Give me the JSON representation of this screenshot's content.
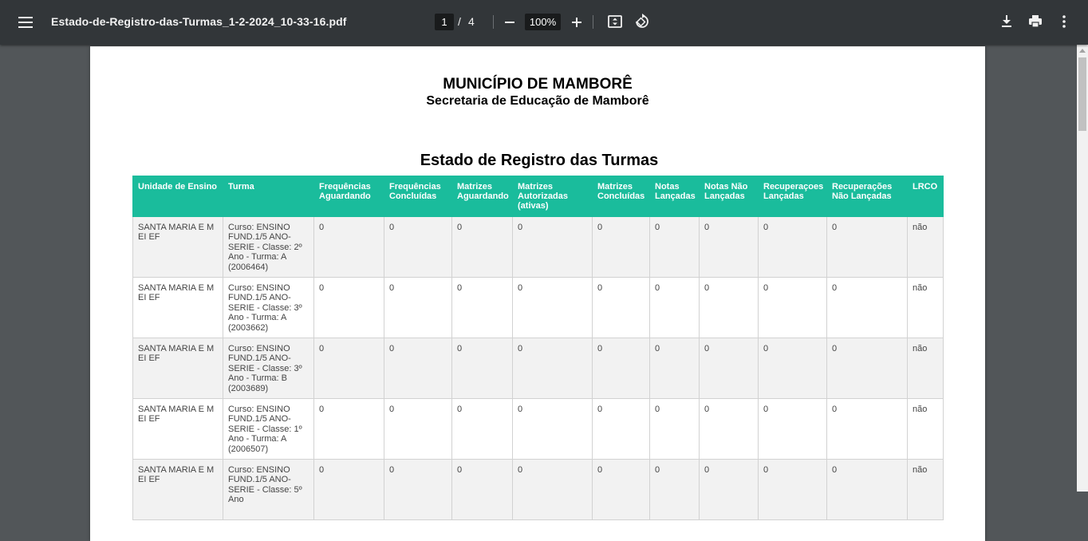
{
  "viewer": {
    "filename": "Estado-de-Registro-das-Turmas_1-2-2024_10-33-16.pdf",
    "page_current": "1",
    "page_separator": "/",
    "page_total": "4",
    "zoom": "100%"
  },
  "document": {
    "org_name": "MUNICÍPIO DE MAMBORÊ",
    "org_dept": "Secretaria de Educação de Mamborê",
    "title": "Estado de Registro das Turmas",
    "columns": [
      "Unidade de Ensino",
      "Turma",
      "Frequências Aguardando",
      "Frequências Concluídas",
      "Matrizes Aguardando",
      "Matrizes Autorizadas (ativas)",
      "Matrizes Concluídas",
      "Notas Lançadas",
      "Notas Não Lançadas",
      "Recuperaçoes Lançadas",
      "Recuperações Não Lançadas",
      "LRCO"
    ],
    "rows": [
      [
        "SANTA MARIA E M EI EF",
        "Curso: ENSINO FUND.1/5 ANO-SERIE - Classe: 2º Ano - Turma: A (2006464)",
        "0",
        "0",
        "0",
        "0",
        "0",
        "0",
        "0",
        "0",
        "0",
        "não"
      ],
      [
        "SANTA MARIA E M EI EF",
        "Curso: ENSINO FUND.1/5 ANO-SERIE - Classe: 3º Ano - Turma: A (2003662)",
        "0",
        "0",
        "0",
        "0",
        "0",
        "0",
        "0",
        "0",
        "0",
        "não"
      ],
      [
        "SANTA MARIA E M EI EF",
        "Curso: ENSINO FUND.1/5 ANO-SERIE - Classe: 3º Ano - Turma: B (2003689)",
        "0",
        "0",
        "0",
        "0",
        "0",
        "0",
        "0",
        "0",
        "0",
        "não"
      ],
      [
        "SANTA MARIA E M EI EF",
        "Curso: ENSINO FUND.1/5 ANO-SERIE - Classe: 1º Ano - Turma: A (2006507)",
        "0",
        "0",
        "0",
        "0",
        "0",
        "0",
        "0",
        "0",
        "0",
        "não"
      ],
      [
        "SANTA MARIA E M EI EF",
        "Curso: ENSINO FUND.1/5 ANO-SERIE - Classe: 5º Ano",
        "0",
        "0",
        "0",
        "0",
        "0",
        "0",
        "0",
        "0",
        "0",
        "não"
      ]
    ]
  },
  "colors": {
    "toolbar_bg": "#323639",
    "viewer_bg": "#525659",
    "table_header": "#1abc9c"
  },
  "icons": [
    "menu-icon",
    "zoom-out-icon",
    "zoom-in-icon",
    "fit-page-icon",
    "rotate-icon",
    "download-icon",
    "print-icon",
    "more-vert-icon"
  ]
}
